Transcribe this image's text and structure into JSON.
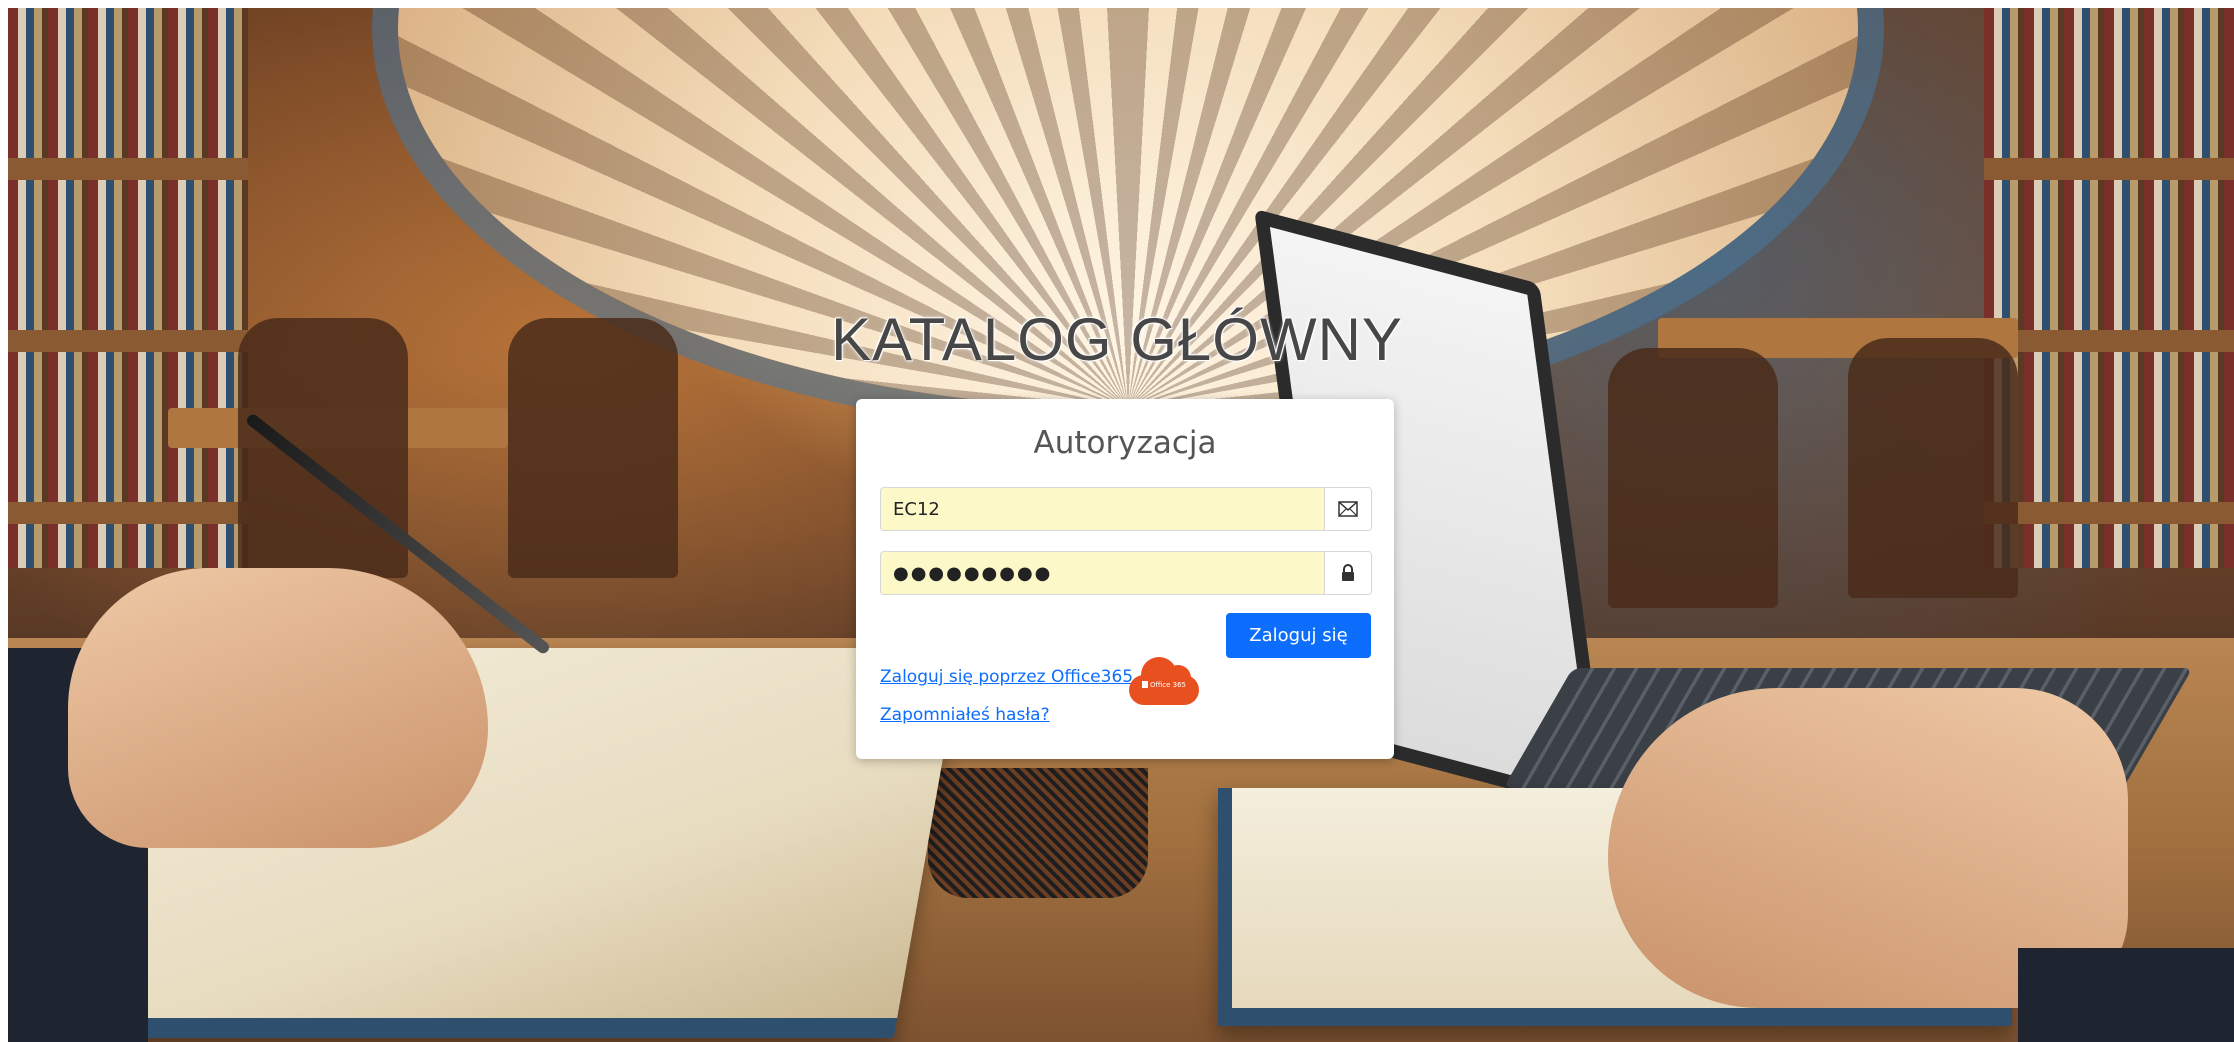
{
  "page": {
    "title": "KATALOG GŁÓWNY"
  },
  "login": {
    "heading": "Autoryzacja",
    "username_value": "EC12",
    "password_value": "●●●●●●●●●",
    "submit_label": "Zaloguj się",
    "office365_link": "Zaloguj się poprzez Office365",
    "office365_badge_text": "Office 365",
    "forgot_link": "Zapomniałeś hasła?"
  },
  "icons": {
    "username_addon": "envelope-icon",
    "password_addon": "lock-icon",
    "office365": "office365-cloud-icon"
  },
  "colors": {
    "primary": "#0d6efd",
    "input_autofill": "#fdf8c8",
    "office365_brand": "#e9501f",
    "title_text": "#474747"
  }
}
